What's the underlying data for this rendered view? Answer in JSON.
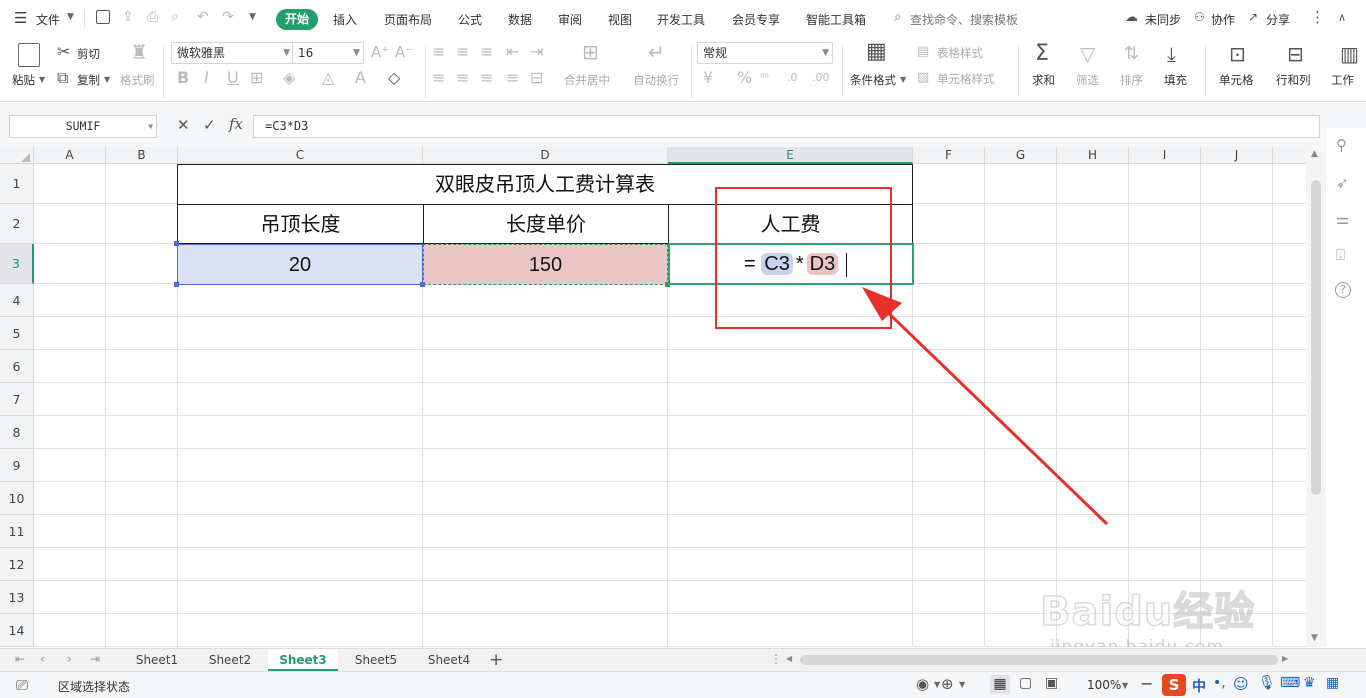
{
  "menu": {
    "file": "文件",
    "tabs": [
      "开始",
      "插入",
      "页面布局",
      "公式",
      "数据",
      "审阅",
      "视图",
      "开发工具",
      "会员专享",
      "智能工具箱"
    ],
    "search_placeholder": "查找命令、搜索模板",
    "sync": "未同步",
    "collab": "协作",
    "share": "分享"
  },
  "ribbon": {
    "paste": "粘贴",
    "cut": "剪切",
    "copy": "复制",
    "format_painter": "格式刷",
    "font_name": "微软雅黑",
    "font_size": "16",
    "merge_center": "合并居中",
    "wrap_text": "自动换行",
    "number_format": "常规",
    "cond_format": "条件格式",
    "table_style": "表格样式",
    "cell_style": "单元格样式",
    "sum": "求和",
    "filter": "筛选",
    "sort": "排序",
    "fill": "填充",
    "cell": "单元格",
    "row_col": "行和列",
    "worksheet": "工作"
  },
  "formula_bar": {
    "name_box": "SUMIF",
    "fx": "fx",
    "formula": "=C3*D3"
  },
  "grid": {
    "columns": [
      "A",
      "B",
      "C",
      "D",
      "E",
      "F",
      "G",
      "H",
      "I",
      "J"
    ],
    "rows": [
      "1",
      "2",
      "3",
      "4",
      "5",
      "6",
      "7",
      "8",
      "9",
      "10",
      "11",
      "12",
      "13",
      "14"
    ],
    "title": "双眼皮吊顶人工费计算表",
    "headers": [
      "吊顶长度",
      "长度单价",
      "人工费"
    ],
    "c3": "20",
    "d3": "150",
    "edit_eq": "=",
    "edit_ref1": "C3",
    "edit_op": "*",
    "edit_ref2": "D3"
  },
  "sheets": [
    "Sheet1",
    "Sheet2",
    "Sheet3",
    "Sheet5",
    "Sheet4"
  ],
  "active_sheet": "Sheet3",
  "status": {
    "mode": "区域选择状态",
    "zoom": "100%"
  },
  "watermark": {
    "brand": "Baidu经验",
    "url": "jingyan.baidu.com"
  },
  "colors": {
    "accent": "#22a06b",
    "c3_fill": "#dbe1f5",
    "d3_fill": "#eac6c4",
    "annotation": "#e8302a"
  }
}
